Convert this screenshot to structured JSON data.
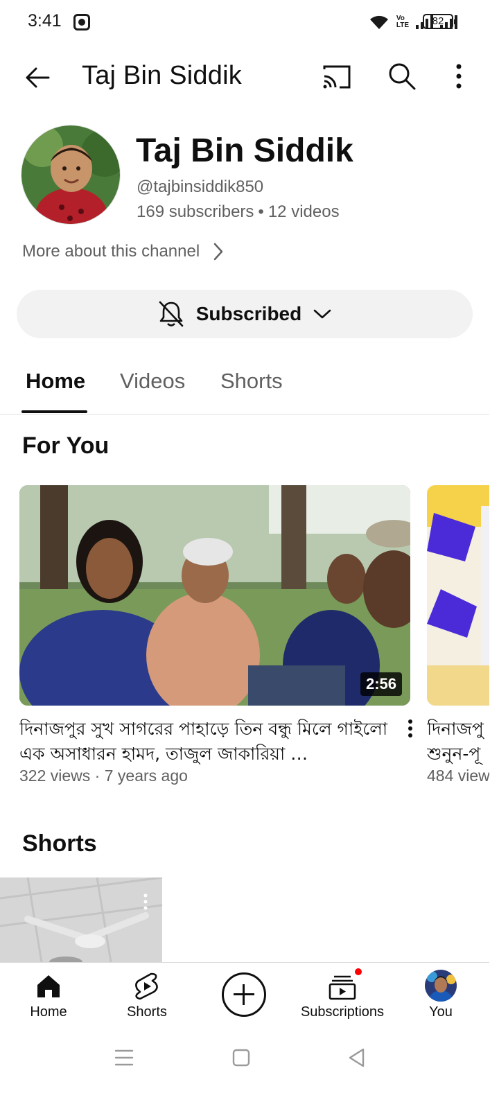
{
  "status_bar": {
    "time": "3:41",
    "volte_line1": "Vo",
    "volte_line2": "LTE",
    "battery": "82"
  },
  "app_bar": {
    "title": "Taj Bin Siddik"
  },
  "channel": {
    "name": "Taj Bin Siddik",
    "handle": "@tajbinsiddik850",
    "subscribers": "169 subscribers",
    "separator": "•",
    "videos": "12 videos",
    "more_about": "More about this channel",
    "subscribe_state": "Subscribed"
  },
  "tabs": [
    {
      "label": "Home"
    },
    {
      "label": "Videos"
    },
    {
      "label": "Shorts"
    }
  ],
  "for_you": {
    "title": "For You",
    "videos": [
      {
        "title": "দিনাজপুর সুখ সাগরের পাহাড়ে তিন বন্ধু মিলে গাইলো এক অসাধারন হামদ, তাজুল জাকারিয়া …",
        "duration": "2:56",
        "meta": "322 views · 7 years ago"
      },
      {
        "title_line1": "দিনাজপু",
        "title_line2": "শুনুন-পূ",
        "meta": "484 view"
      }
    ]
  },
  "shorts_section": {
    "title": "Shorts"
  },
  "bottom_nav": {
    "home": "Home",
    "shorts": "Shorts",
    "subscriptions": "Subscriptions",
    "you": "You"
  },
  "colors": {
    "text_primary": "#0f0f0f",
    "text_secondary": "#606060",
    "chip_bg": "#f2f2f2",
    "notification": "#ff0000"
  },
  "icons": [
    "back-arrow-icon",
    "cast-icon",
    "search-icon",
    "more-vert-icon",
    "chevron-right-icon",
    "bell-off-icon",
    "chevron-down-icon",
    "home-icon",
    "shorts-icon",
    "create-icon",
    "subscriptions-icon"
  ]
}
